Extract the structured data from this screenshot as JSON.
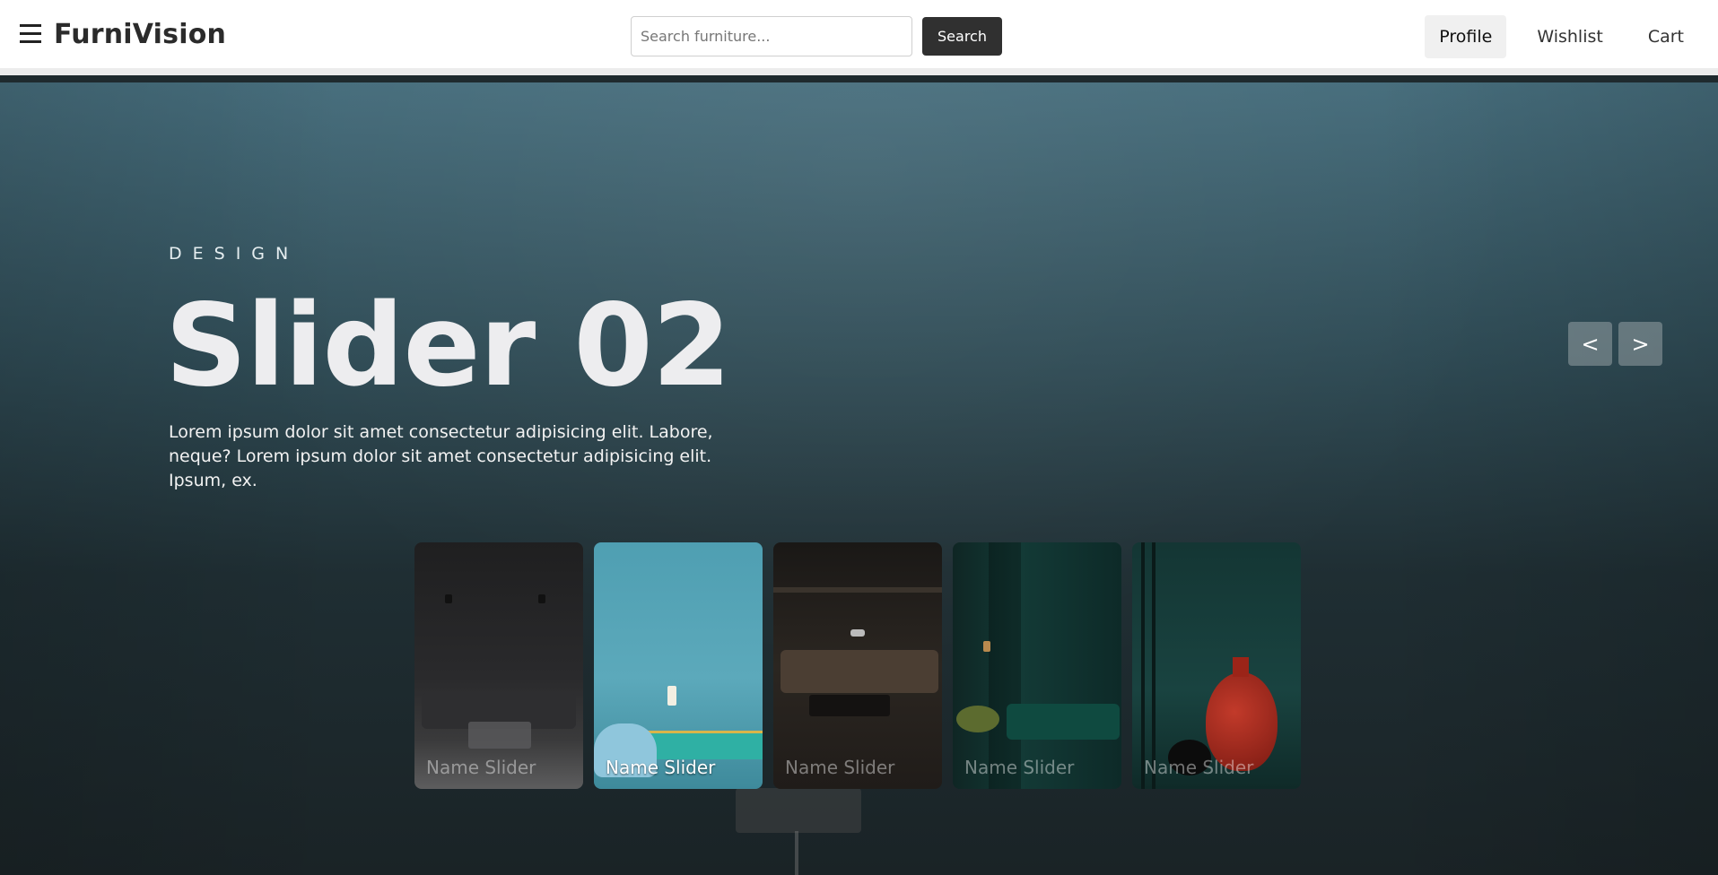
{
  "header": {
    "brand": "FurniVision",
    "search": {
      "placeholder": "Search furniture...",
      "button_label": "Search"
    },
    "nav": [
      {
        "label": "Profile",
        "active": true
      },
      {
        "label": "Wishlist",
        "active": false
      },
      {
        "label": "Cart",
        "active": false
      }
    ]
  },
  "hero": {
    "eyebrow": "DESIGN",
    "title": "Slider 02",
    "description": "Lorem ipsum dolor sit amet consectetur adipisicing elit. Labore, neque? Lorem ipsum dolor sit amet consectetur adipisicing elit. Ipsum, ex.",
    "prev_label": "<",
    "next_label": ">",
    "thumbnails": [
      {
        "label": "Name Slider",
        "active": false
      },
      {
        "label": "Name Slider",
        "active": true
      },
      {
        "label": "Name Slider",
        "active": false
      },
      {
        "label": "Name Slider",
        "active": false
      },
      {
        "label": "Name Slider",
        "active": false
      }
    ]
  },
  "colors": {
    "header_bg": "#ffffff",
    "button_dark": "#303030",
    "hero_top": "#466d7c",
    "hero_bottom": "#1a2326"
  },
  "icons": {
    "menu": "hamburger-menu-icon"
  }
}
